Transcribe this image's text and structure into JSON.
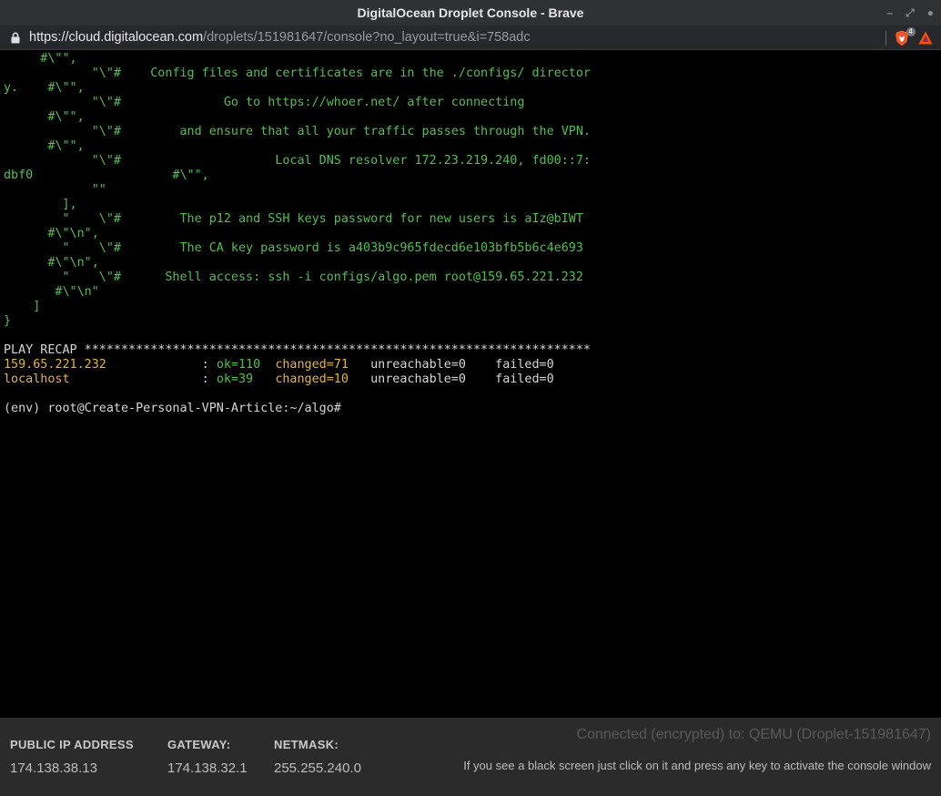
{
  "window": {
    "title": "DigitalOcean Droplet Console - Brave",
    "controls": {
      "minimize": "–",
      "maximize": "⤢",
      "close": "●"
    }
  },
  "urlbar": {
    "url_prefix": "https://",
    "url_host": "cloud.digitalocean.com",
    "url_path": "/droplets/151981647/console?no_layout=true&i=758adc",
    "brave_badge": "4"
  },
  "terminal": {
    "lines": [
      {
        "segments": [
          {
            "t": "     #\\\"\",",
            "c": "green"
          }
        ]
      },
      {
        "segments": [
          {
            "t": "            \"\\\"#    Config files and certificates are in the ./configs/ director",
            "c": "green"
          }
        ]
      },
      {
        "segments": [
          {
            "t": "y.    #\\\"\",",
            "c": "green"
          }
        ]
      },
      {
        "segments": [
          {
            "t": "            \"\\\"#              Go to https://whoer.net/ after connecting",
            "c": "green"
          }
        ]
      },
      {
        "segments": [
          {
            "t": "      #\\\"\",",
            "c": "green"
          }
        ]
      },
      {
        "segments": [
          {
            "t": "            \"\\\"#        and ensure that all your traffic passes through the VPN.",
            "c": "green"
          }
        ]
      },
      {
        "segments": [
          {
            "t": "      #\\\"\",",
            "c": "green"
          }
        ]
      },
      {
        "segments": [
          {
            "t": "            \"\\\"#                     Local DNS resolver 172.23.219.240, fd00::7:",
            "c": "green"
          }
        ]
      },
      {
        "segments": [
          {
            "t": "dbf0                   #\\\"\",",
            "c": "green"
          }
        ]
      },
      {
        "segments": [
          {
            "t": "            \"\"",
            "c": "green"
          }
        ]
      },
      {
        "segments": [
          {
            "t": "        ],",
            "c": "green"
          }
        ]
      },
      {
        "segments": [
          {
            "t": "        \"    \\\"#        The p12 and SSH keys password for new users is aIz@bIWT",
            "c": "green"
          }
        ]
      },
      {
        "segments": [
          {
            "t": "      #\\\"\\n\",",
            "c": "green"
          }
        ]
      },
      {
        "segments": [
          {
            "t": "        \"    \\\"#        The CA key password is a403b9c965fdecd6e103bfb5b6c4e693",
            "c": "green"
          }
        ]
      },
      {
        "segments": [
          {
            "t": "      #\\\"\\n\",",
            "c": "green"
          }
        ]
      },
      {
        "segments": [
          {
            "t": "        \"    \\\"#      Shell access: ssh -i configs/algo.pem root@159.65.221.232",
            "c": "green"
          }
        ]
      },
      {
        "segments": [
          {
            "t": "       #\\\"\\n\"",
            "c": "green"
          }
        ]
      },
      {
        "segments": [
          {
            "t": "    ]",
            "c": "green"
          }
        ]
      },
      {
        "segments": [
          {
            "t": "}",
            "c": "green"
          }
        ]
      },
      {
        "segments": [
          {
            "t": "",
            "c": "white"
          }
        ]
      },
      {
        "segments": [
          {
            "t": "PLAY RECAP *********************************************************************",
            "c": "white"
          }
        ]
      },
      {
        "segments": [
          {
            "t": "159.65.221.232",
            "c": "yellow"
          },
          {
            "t": "             : ",
            "c": "white"
          },
          {
            "t": "ok=110",
            "c": "green"
          },
          {
            "t": "  ",
            "c": "white"
          },
          {
            "t": "changed=71",
            "c": "yellow"
          },
          {
            "t": "   unreachable=0    failed=0",
            "c": "white"
          }
        ]
      },
      {
        "segments": [
          {
            "t": "localhost",
            "c": "yellow"
          },
          {
            "t": "                  : ",
            "c": "white"
          },
          {
            "t": "ok=39",
            "c": "green"
          },
          {
            "t": "   ",
            "c": "white"
          },
          {
            "t": "changed=10",
            "c": "yellow"
          },
          {
            "t": "   unreachable=0    failed=0",
            "c": "white"
          }
        ]
      },
      {
        "segments": [
          {
            "t": "",
            "c": "white"
          }
        ]
      },
      {
        "segments": [
          {
            "t": "(env) root@Create-Personal-VPN-Article:~/algo#",
            "c": "white"
          }
        ]
      }
    ]
  },
  "footer": {
    "public_ip_label": "PUBLIC IP ADDRESS",
    "public_ip_value": "174.138.38.13",
    "gateway_label": "GATEWAY:",
    "gateway_value": "174.138.32.1",
    "netmask_label": "NETMASK:",
    "netmask_value": "255.255.240.0",
    "connection_status": "Connected (encrypted) to: QEMU (Droplet-151981647)",
    "hint": "If you see a black screen just click on it and press any key to activate the console window"
  },
  "colors": {
    "terminal_green": "#4ec24e",
    "terminal_yellow": "#e5b53c",
    "terminal_white": "#d6d6d6",
    "brave_orange": "#f1562b"
  },
  "icons": {
    "lock": "lock-icon",
    "brave": "brave-lion-icon",
    "rewards": "bat-triangle-icon"
  }
}
